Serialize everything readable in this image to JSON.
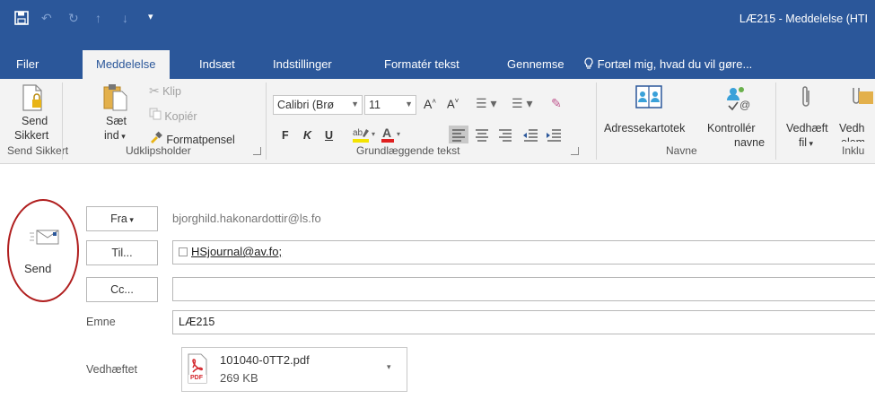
{
  "window": {
    "title": "LÆ215 - Meddelelse (HTI"
  },
  "tabs": [
    {
      "label": "Filer"
    },
    {
      "label": "Meddelelse"
    },
    {
      "label": "Indsæt"
    },
    {
      "label": "Indstillinger"
    },
    {
      "label": "Formatér tekst"
    },
    {
      "label": "Gennemse"
    }
  ],
  "tellme": "Fortæl mig, hvad du vil gøre...",
  "ribbon": {
    "send_secure": {
      "line1": "Send",
      "line2": "Sikkert",
      "group": "Send Sikkert"
    },
    "clipboard": {
      "paste_line1": "Sæt",
      "paste_line2": "ind",
      "cut": "Klip",
      "copy": "Kopiér",
      "format_painter": "Formatpensel",
      "group": "Udklipsholder"
    },
    "basic_text": {
      "font": "Calibri (Brø",
      "size": "11",
      "bold": "F",
      "italic": "K",
      "underline": "U",
      "group": "Grundlæggende tekst"
    },
    "names": {
      "address_book": "Adressekartotek",
      "check_line1": "Kontrollér",
      "check_line2": "navne",
      "group": "Navne"
    },
    "include": {
      "attach_line1": "Vedhæft",
      "attach_line2": "fil",
      "elem_line1": "Vedh",
      "elem_line2": "elem",
      "group": "Inklu"
    }
  },
  "compose": {
    "send_label": "Send",
    "from_button": "Fra",
    "from_value": "bjorghild.hakonardottir@ls.fo",
    "to_button": "Til...",
    "to_value": "HSjournal@av.fo;",
    "cc_button": "Cc...",
    "subject_label": "Emne",
    "subject_value": "LÆ215",
    "attachment_label": "Vedhæftet",
    "attachment": {
      "name": "101040-0TT2.pdf",
      "size": "269 KB",
      "badge": "PDF"
    }
  },
  "colors": {
    "brand": "#2b579a",
    "highlight_oval": "#b01e1e"
  }
}
